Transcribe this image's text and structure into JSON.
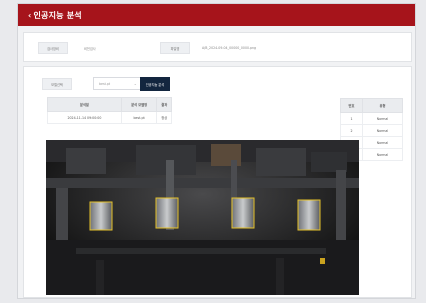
{
  "header": {
    "back_icon": "‹",
    "title": "인공지능 분석"
  },
  "info": {
    "field1_label": "검사장비",
    "field1_value": "비전검사",
    "field2_label": "파일명",
    "field2_value": "A/B_2024-09-04_00000_0000.png"
  },
  "controls": {
    "model_label": "모델선택",
    "model_select_value": "best.pt",
    "analyze_button": "인공지능 분석"
  },
  "history_table": {
    "columns": [
      "분석일",
      "분석 모델명",
      "결과"
    ],
    "rows": [
      [
        "2024-11-14 09:00:00",
        "best.pt",
        "정상"
      ]
    ]
  },
  "result_table": {
    "columns": [
      "번호",
      "유형"
    ],
    "rows": [
      [
        "1",
        "Normal"
      ],
      [
        "2",
        "Normal"
      ],
      [
        "3",
        "Normal"
      ],
      [
        "4",
        "Normal"
      ]
    ]
  },
  "detections": {
    "count": 4,
    "label": "Normal",
    "box_color": "#e6c229"
  },
  "colors": {
    "accent": "#a6141b",
    "button": "#13263f"
  }
}
